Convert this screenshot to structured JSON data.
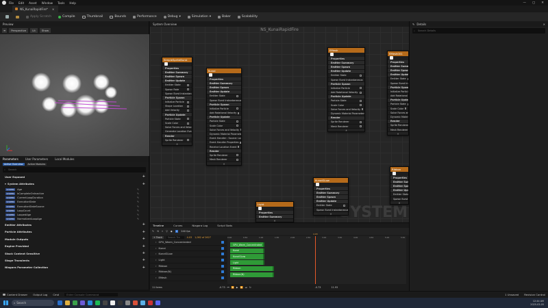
{
  "menu": [
    "File",
    "Edit",
    "Asset",
    "Window",
    "Tools",
    "Help"
  ],
  "window_controls": [
    "—",
    "▢",
    "✕"
  ],
  "asset_tab": "NS_KunaiRapidFire*",
  "toolbar": {
    "apply": "Apply Scratch",
    "compile": "Compile",
    "thumbnail": "Thumbnail",
    "bounds": "Bounds",
    "performance": "Performance",
    "debug": "Debug",
    "simulation": "Simulation",
    "baker": "Baker",
    "scalability": "Scalability"
  },
  "preview": {
    "tab": "Preview",
    "perspective": "Perspective",
    "lit": "Lit",
    "show": "Show"
  },
  "params": {
    "tabs": [
      "Parameters",
      "User Parameters",
      "Local Modules"
    ],
    "subtabs": [
      "Active Overview",
      "Active Modules"
    ],
    "search_placeholder": "Search",
    "sections": {
      "user_exposed": "User Exposed",
      "system_attributes": "System Attributes"
    },
    "system_attrs": [
      {
        "tag": "SYSTEM",
        "name": "Age"
      },
      {
        "tag": "SYSTEM",
        "name": "bCompleteOnInactive"
      },
      {
        "tag": "SYSTEM",
        "name": "CurrentLoopDuration"
      },
      {
        "tag": "SYSTEM",
        "name": "ExecutionState"
      },
      {
        "tag": "SYSTEM",
        "name": "ExecutionStateSource"
      },
      {
        "tag": "SYSTEM",
        "name": "LoopCount"
      },
      {
        "tag": "SYSTEM",
        "name": "LoopedAge"
      },
      {
        "tag": "SYSTEM",
        "name": "NormalizedLoopAge"
      }
    ],
    "other_sections": [
      "Emitter Attributes",
      "Particle Attributes",
      "Module Outputs",
      "Engine Provided",
      "Stack Context Sensitive",
      "Stage Transients",
      "Niagara Parameter Collection"
    ]
  },
  "graph": {
    "tab": "System Overview",
    "title": "NS_KunaiRapidFire",
    "watermark": "SYSTEM",
    "nodes": [
      {
        "title": "SimpleSpriteBurst",
        "rows": [
          "Properties",
          "Emitter Summary",
          "Emitter Spawn",
          "Emitter Update",
          "Emitter State",
          "Spawn Rate",
          "Spawn Burst Instantaneous",
          "Particle Spawn",
          "Initialize Particle",
          "Shape Location",
          "Add Velocity",
          "Particle Update",
          "Particle State",
          "Scale Color",
          "Solve Forces and Velocity",
          "Generate Location Event",
          "Render",
          "Sprite Renderer"
        ]
      },
      {
        "title": "Kunai",
        "rows": [
          "Properties",
          "Emitter Summary",
          "Emitter Spawn",
          "Emitter Update",
          "Emitter State",
          "Spawn Burst Instantaneous",
          "Particle Spawn",
          "Initialize Particle",
          "Add Rotational Velocity",
          "Particle Update",
          "Particle State",
          "Scale Color",
          "Solve Forces and Velocity",
          "Dynamic Material Parameters",
          "Event Handler : Source: LocationEvent",
          "Event Handler Properties",
          "Receive Location Event",
          "Render",
          "Sprite Renderer",
          "Mesh Renderer"
        ]
      },
      {
        "title": "EMesh",
        "rows": [
          "Properties",
          "Emitter Summary",
          "Emitter Spawn",
          "Emitter Update",
          "Emitter State",
          "Spawn Burst Instantaneous",
          "Particle Spawn",
          "Initialize Particle",
          "Add Rotational Velocity",
          "Particle Update",
          "Particle State",
          "Scale Color",
          "Solve Forces and Velocity",
          "Dynamic Material Parameters",
          "Render",
          "Sprite Renderer",
          "Mesh Renderer"
        ]
      },
      {
        "title": "EMesh001",
        "rows": [
          "Properties",
          "Emitter Summary",
          "Emitter Spawn",
          "Emitter Update",
          "Emitter State",
          "Spawn Burst Instantaneous",
          "Particle Spawn",
          "Initialize Particle",
          "Add Rotational Velocity",
          "Particle Update",
          "Particle State",
          "Scale Color",
          "Solve Forces and Velocity",
          "Dynamic Material Parameters",
          "Render",
          "Sprite Renderer",
          "Mesh Renderer"
        ]
      },
      {
        "title": "KunaiGLow",
        "rows": [
          "Properties",
          "Emitter Summary",
          "Emitter Spawn",
          "Emitter Update",
          "Emitter State",
          "Spawn Burst Instantaneous"
        ]
      },
      {
        "title": "Light",
        "rows": [
          "Properties",
          "Emitter Summary"
        ]
      },
      {
        "title": "Ribbon",
        "rows": [
          "Properties",
          "Emitter Summary",
          "Emitter Spawn",
          "Emitter Update",
          "Emitter State",
          "Spawn Burst Instantaneous"
        ]
      }
    ]
  },
  "timeline": {
    "tabs": [
      "Timeline",
      "Curves",
      "Niagara Log",
      "Script Stats"
    ],
    "fps": "240 fps",
    "track_btn": "+ Track",
    "search": "Search Tra",
    "time": "4.03",
    "range": "1,082 of 2627",
    "ticks": [
      "0.00",
      "0.50",
      "1.00",
      "1.50",
      "2.00",
      "2.50",
      "3.00",
      "3.50",
      "4.00",
      "4.50",
      "5.00",
      "5.50"
    ],
    "tracks": [
      "GPU_Warm_Concentrated",
      "Kunai",
      "KunaiGLow",
      "Light",
      "Ribbon",
      "Ribbon(N)",
      "EMesh"
    ],
    "bars": [
      "GPU_Warm_Concentrated",
      "Kunai",
      "KunaiGLow",
      "Light",
      "Ribbon",
      "Ribbon(N)"
    ],
    "count": "11 items",
    "start": "-0.73",
    "end": "11.93",
    "neg": "-0.73"
  },
  "details": {
    "title": "Details",
    "search_placeholder": "Search Details"
  },
  "status": {
    "content_drawer": "Content Drawer",
    "output_log": "Output Log",
    "cmd": "Cmd",
    "console_placeholder": "Enter Console Command",
    "unsaved": "1 Unsaved",
    "revision": "Revision Control"
  },
  "taskbar": {
    "search": "Search",
    "time": "12:44 AM",
    "date": "2025-03-05"
  }
}
